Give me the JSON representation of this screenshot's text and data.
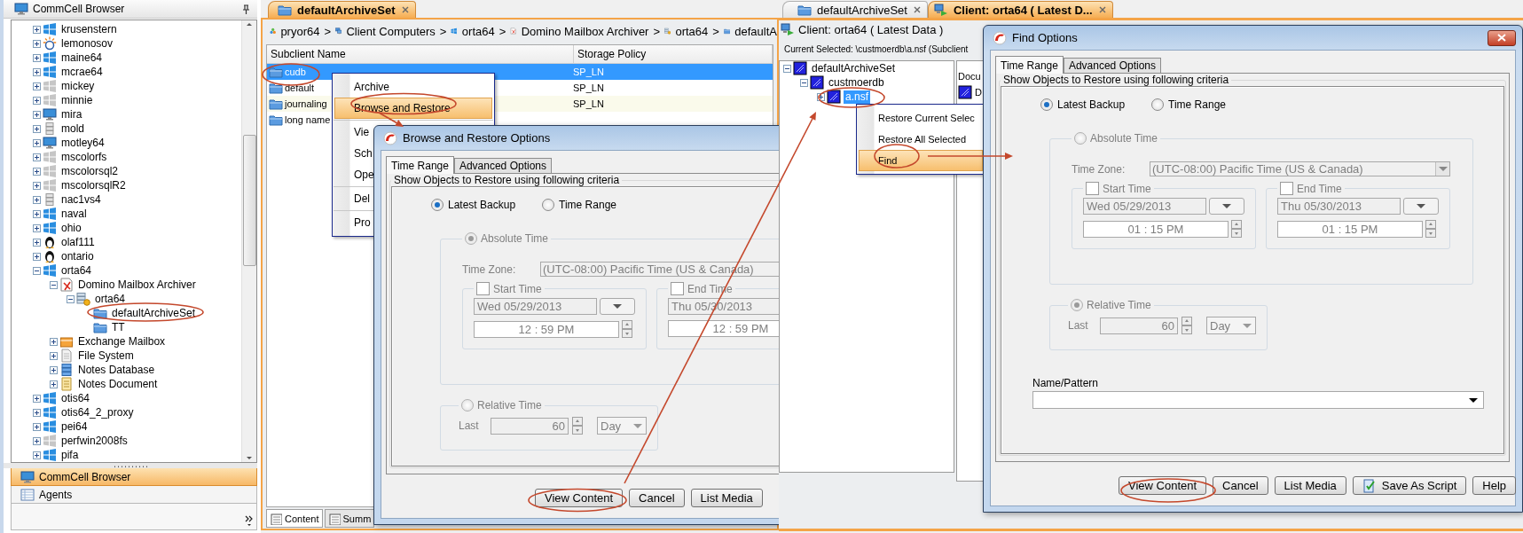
{
  "left_panel": {
    "title": "CommCell Browser",
    "tree": [
      {
        "label": "krusenstern",
        "kind": "windows",
        "expanded": false
      },
      {
        "label": "lemonosov",
        "kind": "unix",
        "expanded": false
      },
      {
        "label": "maine64",
        "kind": "windows",
        "expanded": false
      },
      {
        "label": "mcrae64",
        "kind": "windows",
        "expanded": false
      },
      {
        "label": "mickey",
        "kind": "offline",
        "expanded": false
      },
      {
        "label": "minnie",
        "kind": "offline",
        "expanded": false
      },
      {
        "label": "mira",
        "kind": "workstation",
        "expanded": false
      },
      {
        "label": "mold",
        "kind": "server",
        "expanded": false
      },
      {
        "label": "motley64",
        "kind": "workstation",
        "expanded": false
      },
      {
        "label": "mscolorfs",
        "kind": "offline",
        "expanded": false
      },
      {
        "label": "mscolorsql2",
        "kind": "offline",
        "expanded": false
      },
      {
        "label": "mscolorsqlR2",
        "kind": "offline",
        "expanded": false
      },
      {
        "label": "nac1vs4",
        "kind": "server",
        "expanded": false
      },
      {
        "label": "naval",
        "kind": "windows",
        "expanded": false
      },
      {
        "label": "ohio",
        "kind": "windows",
        "expanded": false
      },
      {
        "label": "olaf111",
        "kind": "linux",
        "expanded": false
      },
      {
        "label": "ontario",
        "kind": "linux",
        "expanded": false
      },
      {
        "label": "orta64",
        "kind": "windows",
        "expanded": true,
        "children": [
          {
            "label": "Domino Mailbox Archiver",
            "kind": "agent",
            "expanded": true,
            "children": [
              {
                "label": "orta64",
                "kind": "instance",
                "expanded": true,
                "children": [
                  {
                    "label": "defaultArchiveSet",
                    "kind": "archive_set"
                  },
                  {
                    "label": "TT",
                    "kind": "archive_set"
                  }
                ]
              }
            ]
          },
          {
            "label": "Exchange Mailbox",
            "kind": "exchange",
            "expanded": false
          },
          {
            "label": "File System",
            "kind": "file_system",
            "expanded": false
          },
          {
            "label": "Notes Database",
            "kind": "notes_db",
            "expanded": false
          },
          {
            "label": "Notes Document",
            "kind": "notes_doc",
            "expanded": false
          }
        ]
      },
      {
        "label": "otis64",
        "kind": "windows",
        "expanded": false
      },
      {
        "label": "otis64_2_proxy",
        "kind": "windows",
        "expanded": false
      },
      {
        "label": "pei64",
        "kind": "windows",
        "expanded": false
      },
      {
        "label": "perfwin2008fs",
        "kind": "offline",
        "expanded": false
      },
      {
        "label": "pifa",
        "kind": "windows",
        "expanded": false
      }
    ],
    "nav_tabs": [
      {
        "label": "CommCell Browser",
        "kind": "commcell",
        "selected": true
      },
      {
        "label": "Agents",
        "kind": "agents",
        "selected": false
      }
    ]
  },
  "middle_panel": {
    "tab": {
      "label": "defaultArchiveSet"
    },
    "breadcrumb": [
      {
        "label": "pryor64",
        "kind": "commcell",
        "separator": ">"
      },
      {
        "label": "Client Computers",
        "kind": "computers",
        "separator": ">"
      },
      {
        "label": "orta64",
        "kind": "windows",
        "separator": ">"
      },
      {
        "label": "Domino Mailbox Archiver",
        "kind": "agent",
        "separator": ">"
      },
      {
        "label": "orta64",
        "kind": "instance",
        "separator": ">"
      },
      {
        "label": "defaultA",
        "kind": "archive_set"
      }
    ],
    "table": {
      "columns": [
        "Subclient Name",
        "Storage Policy"
      ],
      "rows": [
        {
          "name": "cudb",
          "policy": "SP_LN",
          "selected": true
        },
        {
          "name": "default",
          "policy": "SP_LN",
          "selected": false
        },
        {
          "name": "journaling",
          "policy": "SP_LN",
          "selected": false
        },
        {
          "name": "long name",
          "selected": false
        }
      ]
    },
    "context_menu": {
      "items": [
        {
          "label": "Archive",
          "highlighted": false
        },
        {
          "label": "Browse and Restore",
          "highlighted": true
        },
        {
          "kind": "separator"
        },
        {
          "label": "Vie",
          "highlighted": false
        },
        {
          "label": "Sch",
          "highlighted": false
        },
        {
          "label": "Ope",
          "highlighted": false
        },
        {
          "kind": "separator"
        },
        {
          "label": "Del",
          "highlighted": false
        },
        {
          "kind": "separator"
        },
        {
          "label": "Pro",
          "highlighted": false
        }
      ]
    },
    "bottom_tabs": [
      {
        "label": "Content",
        "selected": true
      },
      {
        "label": "Summ",
        "selected": false
      }
    ],
    "dialog": {
      "title": "Browse and Restore Options",
      "tabs": [
        {
          "label": "Time Range",
          "selected": true
        },
        {
          "label": "Advanced Options",
          "selected": false
        }
      ],
      "criteria_label": "Show Objects to Restore using following criteria",
      "mode_options": [
        {
          "label": "Latest Backup",
          "selected": true
        },
        {
          "label": "Time Range",
          "selected": false
        }
      ],
      "absolute_time": {
        "label": "Absolute Time",
        "selected": true,
        "disabled": true,
        "time_zone_label": "Time Zone:",
        "time_zone": "(UTC-08:00) Pacific Time (US & Canada)",
        "start": {
          "label": "Start Time",
          "checked": false,
          "date": "Wed 05/29/2013",
          "time": "12 : 59 PM"
        },
        "end": {
          "label": "End Time",
          "checked": false,
          "date": "Thu 05/30/2013",
          "time": "12 : 59 PM"
        }
      },
      "relative_time": {
        "label": "Relative Time",
        "selected": false,
        "disabled": true,
        "last_label": "Last",
        "amount": "60",
        "unit": "Day"
      },
      "buttons": [
        {
          "label": "View Content"
        },
        {
          "label": "Cancel"
        },
        {
          "label": "List Media"
        }
      ]
    }
  },
  "right_panel": {
    "tabs": [
      {
        "label": "defaultArchiveSet",
        "kind": "archive_set",
        "selected": false
      },
      {
        "label": "Client: orta64 ( Latest D...",
        "kind": "client",
        "selected": true
      }
    ],
    "client_label": "Client: orta64 ( Latest Data )",
    "current_selected": "Current Selected: \\custmoerdb\\a.nsf (Subclient",
    "tree": [
      {
        "label": "defaultArchiveSet",
        "expanded": true,
        "selected": false,
        "children": [
          {
            "label": "custmoerdb",
            "expanded": true,
            "selected": false,
            "children": [
              {
                "label": "a.nsf",
                "expanded": false,
                "selected": true
              }
            ]
          }
        ]
      }
    ],
    "list": {
      "column": "Docu",
      "rows": [
        "D"
      ]
    },
    "context_menu": {
      "items": [
        {
          "label": "Restore Current Selec",
          "highlighted": false
        },
        {
          "label": "Restore All Selected",
          "highlighted": false
        },
        {
          "label": "Find",
          "highlighted": true
        }
      ]
    },
    "dialog": {
      "title": "Find Options",
      "close_button": true,
      "tabs": [
        {
          "label": "Time Range",
          "selected": true
        },
        {
          "label": "Advanced Options",
          "selected": false
        }
      ],
      "criteria_label": "Show Objects to Restore using following criteria",
      "mode_options": [
        {
          "label": "Latest Backup",
          "selected": true
        },
        {
          "label": "Time Range",
          "selected": false
        }
      ],
      "absolute_time": {
        "label": "Absolute Time",
        "selected": false,
        "disabled": true,
        "time_zone_label": "Time Zone:",
        "time_zone": "(UTC-08:00) Pacific Time (US & Canada)",
        "start": {
          "label": "Start Time",
          "checked": false,
          "date": "Wed 05/29/2013",
          "time": "01 : 15 PM"
        },
        "end": {
          "label": "End Time",
          "checked": false,
          "date": "Thu 05/30/2013",
          "time": "01 : 15 PM"
        }
      },
      "relative_time": {
        "label": "Relative Time",
        "selected": true,
        "disabled": true,
        "last_label": "Last",
        "amount": "60",
        "unit": "Day"
      },
      "name_pattern": {
        "label": "Name/Pattern"
      },
      "buttons": [
        {
          "label": "View Content"
        },
        {
          "label": "Cancel"
        },
        {
          "label": "List Media"
        },
        {
          "label": "Save As Script",
          "icon": true
        },
        {
          "label": "Help"
        }
      ]
    }
  }
}
